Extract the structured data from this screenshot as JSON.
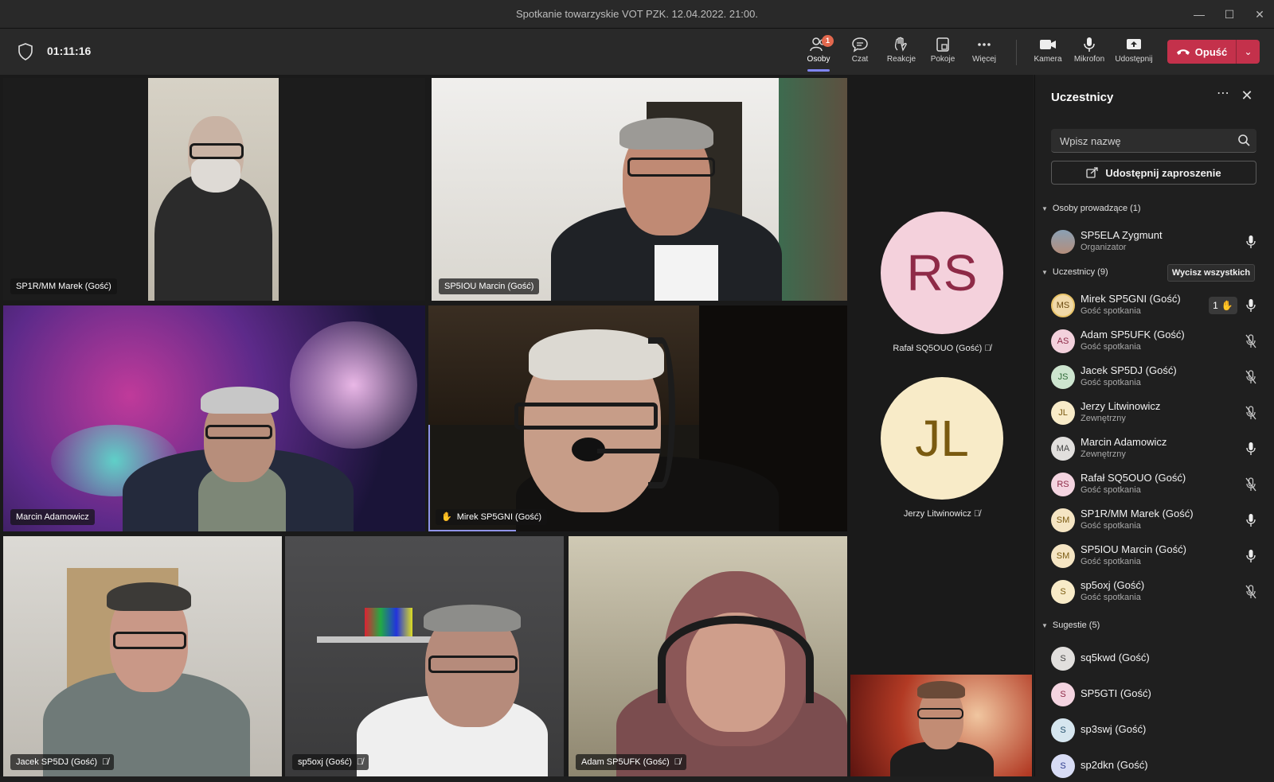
{
  "window": {
    "title": "Spotkanie towarzyskie VOT PZK. 12.04.2022. 21:00."
  },
  "toolbar": {
    "timer": "01:11:16",
    "people": {
      "label": "Osoby",
      "badge": "1"
    },
    "chat": {
      "label": "Czat"
    },
    "reactions": {
      "label": "Reakcje"
    },
    "rooms": {
      "label": "Pokoje"
    },
    "more": {
      "label": "Więcej"
    },
    "camera": {
      "label": "Kamera"
    },
    "mic": {
      "label": "Mikrofon"
    },
    "share": {
      "label": "Udostępnij"
    },
    "leave": {
      "label": "Opuść"
    }
  },
  "tiles": {
    "t1": "SP1R/MM Marek (Gość)",
    "t2": "SP5IOU Marcin (Gość)",
    "t3": "Marcin Adamowicz",
    "t4": "Mirek SP5GNI (Gość)",
    "t5": "Jacek SP5DJ (Gość)",
    "t6": "sp5oxj (Gość)",
    "t7": "Adam SP5UFK (Gość)"
  },
  "avatars": {
    "a1": {
      "initials": "RS",
      "name": "Rafał SQ5OUO (Gość)"
    },
    "a2": {
      "initials": "JL",
      "name": "Jerzy Litwinowicz"
    }
  },
  "panel": {
    "title": "Uczestnicy",
    "search_placeholder": "Wpisz nazwę",
    "share_invite": "Udostępnij zaproszenie",
    "presenters_header": "Osoby prowadzące (1)",
    "organizer": {
      "name": "SP5ELA Zygmunt",
      "role": "Organizator"
    },
    "attendees_header": "Uczestnicy (9)",
    "mute_all": "Wycisz wszystkich",
    "hand_count": "1",
    "attendees": [
      {
        "initials": "MS",
        "name": "Mirek SP5GNI (Gość)",
        "role": "Gość spotkania",
        "color": "#f0d9a8"
      },
      {
        "initials": "AS",
        "name": "Adam SP5UFK (Gość)",
        "role": "Gość spotkania",
        "color": "#f3d1dc"
      },
      {
        "initials": "JS",
        "name": "Jacek SP5DJ (Gość)",
        "role": "Gość spotkania",
        "color": "#cde5cf"
      },
      {
        "initials": "JL",
        "name": "Jerzy Litwinowicz",
        "role": "Zewnętrzny",
        "color": "#f8ebc8"
      },
      {
        "initials": "MA",
        "name": "Marcin Adamowicz",
        "role": "Zewnętrzny",
        "color": "#e1dfdd"
      },
      {
        "initials": "RS",
        "name": "Rafał SQ5OUO (Gość)",
        "role": "Gość spotkania",
        "color": "#f4d4e0"
      },
      {
        "initials": "SM",
        "name": "SP1R/MM Marek (Gość)",
        "role": "Gość spotkania",
        "color": "#f5e5c3"
      },
      {
        "initials": "SM",
        "name": "SP5IOU Marcin (Gość)",
        "role": "Gość spotkania",
        "color": "#f5e5c3"
      },
      {
        "initials": "S",
        "name": "sp5oxj (Gość)",
        "role": "Gość spotkania",
        "color": "#f8ebc8"
      }
    ],
    "suggestions_header": "Sugestie (5)",
    "suggestions": [
      {
        "initials": "S",
        "name": "sq5kwd (Gość)"
      },
      {
        "initials": "S",
        "name": "SP5GTI (Gość)"
      },
      {
        "initials": "S",
        "name": "sp3swj (Gość)"
      },
      {
        "initials": "S",
        "name": "sp2dkn (Gość)"
      }
    ]
  }
}
